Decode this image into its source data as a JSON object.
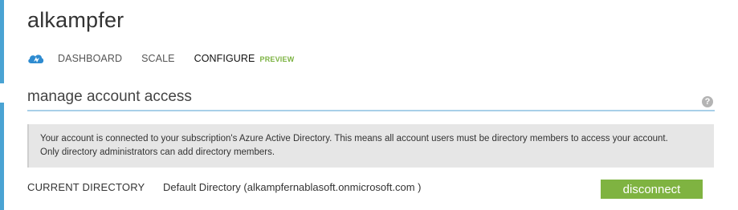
{
  "header": {
    "title": "alkampfer"
  },
  "nav": {
    "icon": "cloud-storage-icon",
    "tabs": [
      {
        "label": "DASHBOARD",
        "active": false
      },
      {
        "label": "SCALE",
        "active": false
      },
      {
        "label": "CONFIGURE",
        "active": true,
        "badge": "PREVIEW"
      }
    ]
  },
  "section": {
    "title": "manage account access",
    "help_icon": "?",
    "info_lines": [
      "Your account is connected to your subscription's Azure Active Directory. This means all account users must be directory members to access your account.",
      "Only directory administrators can add directory members."
    ],
    "current_directory_label": "CURRENT DIRECTORY",
    "current_directory_value": "Default Directory (alkampfernablasoft.onmicrosoft.com )",
    "disconnect_label": "disconnect"
  },
  "colors": {
    "accent": "#4aa3d3",
    "button_green": "#7fb341",
    "preview_green": "#7cb342"
  }
}
